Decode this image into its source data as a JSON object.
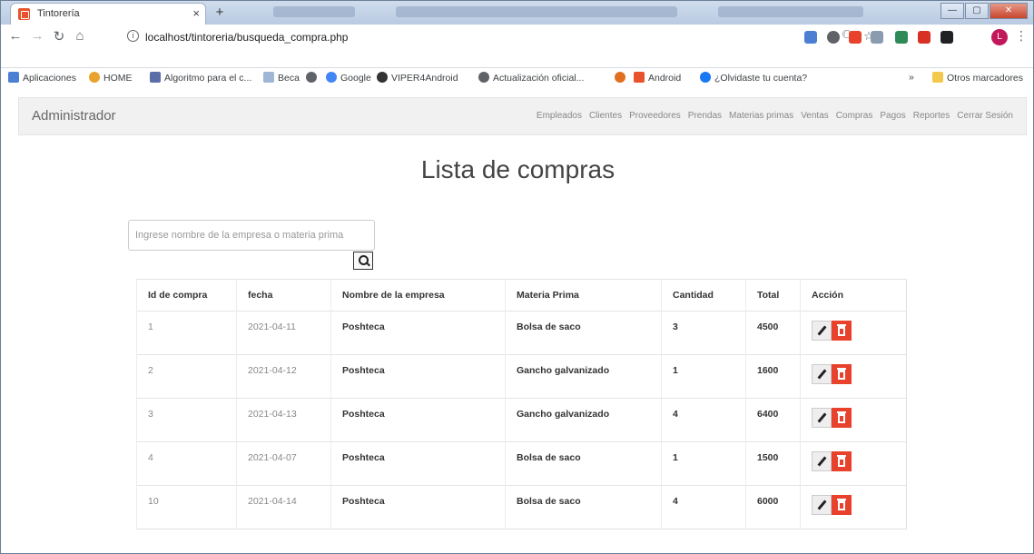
{
  "browser": {
    "tab_title": "Tintorería",
    "url": "localhost/tintoreria/busqueda_compra.php",
    "bookmarks": [
      {
        "label": "Aplicaciones",
        "color": "#4a7fd4"
      },
      {
        "label": "HOME",
        "color": "#e8a22d"
      },
      {
        "label": "Algoritmo para el c...",
        "color": "#5b6ea8"
      },
      {
        "label": "Beca",
        "color": "#9fb6d6"
      },
      {
        "label": "",
        "color": "#5f6368"
      },
      {
        "label": "Google",
        "color": "#4285f4"
      },
      {
        "label": "VIPER4Android",
        "color": "#333333"
      },
      {
        "label": "Actualización oficial...",
        "color": "#5f6368"
      },
      {
        "label": "",
        "color": "#e07020"
      },
      {
        "label": "Android",
        "color": "#e8532d"
      },
      {
        "label": "¿Olvidaste tu cuenta?",
        "color": "#1877f2"
      }
    ],
    "other_bookmarks": "Otros marcadores",
    "avatar_letter": "L"
  },
  "navbar": {
    "brand": "Administrador",
    "links": [
      "Empleados",
      "Clientes",
      "Proveedores",
      "Prendas",
      "Materias primas",
      "Ventas",
      "Compras",
      "Pagos",
      "Reportes",
      "Cerrar Sesión"
    ]
  },
  "page": {
    "title": "Lista de compras",
    "search_placeholder": "Ingrese nombre de la empresa o materia prima"
  },
  "table": {
    "headers": [
      "Id de compra",
      "fecha",
      "Nombre de la empresa",
      "Materia Prima",
      "Cantidad",
      "Total",
      "Acción"
    ],
    "rows": [
      [
        "1",
        "2021-04-11",
        "Poshteca",
        "Bolsa de saco",
        "3",
        "4500"
      ],
      [
        "2",
        "2021-04-12",
        "Poshteca",
        "Gancho galvanizado",
        "1",
        "1600"
      ],
      [
        "3",
        "2021-04-13",
        "Poshteca",
        "Gancho galvanizado",
        "4",
        "6400"
      ],
      [
        "4",
        "2021-04-07",
        "Poshteca",
        "Bolsa de saco",
        "1",
        "1500"
      ],
      [
        "10",
        "2021-04-14",
        "Poshteca",
        "Bolsa de saco",
        "4",
        "6000"
      ]
    ]
  }
}
